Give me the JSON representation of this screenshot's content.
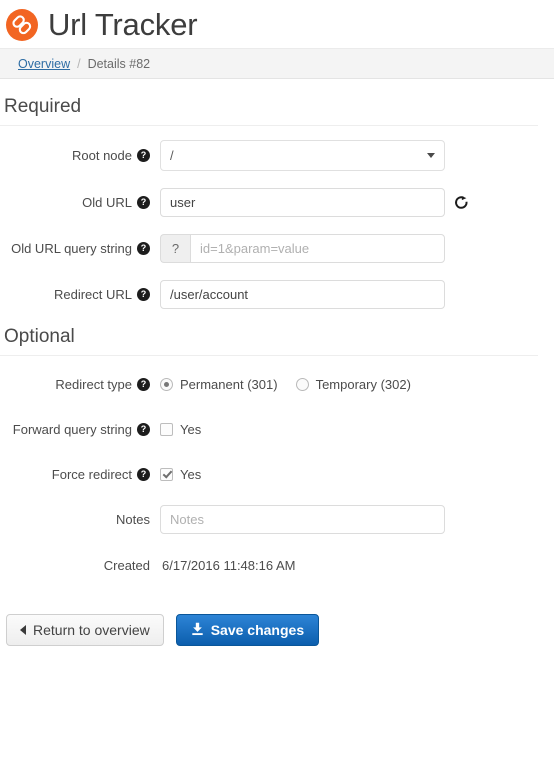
{
  "header": {
    "title": "Url Tracker",
    "logo_icon": "chain-link-icon",
    "logo_color": "#f26522"
  },
  "breadcrumb": {
    "link_label": "Overview",
    "separator": "/",
    "current_label": "Details #82"
  },
  "sections": {
    "required": {
      "title": "Required",
      "root_node": {
        "label": "Root node",
        "help_icon": "question-circle-icon",
        "value": "/",
        "caret_icon": "chevron-down-icon"
      },
      "old_url": {
        "label": "Old URL",
        "help_icon": "question-circle-icon",
        "value": "user",
        "placeholder": "",
        "action_icon": "external-link-icon"
      },
      "old_url_query_string": {
        "label": "Old URL query string",
        "help_icon": "question-circle-icon",
        "addon": "?",
        "value": "",
        "placeholder": "id=1&param=value"
      },
      "redirect_url": {
        "label": "Redirect URL",
        "help_icon": "question-circle-icon",
        "value": "/user/account",
        "placeholder": ""
      }
    },
    "optional": {
      "title": "Optional",
      "redirect_type": {
        "label": "Redirect type",
        "help_icon": "question-circle-icon",
        "options": [
          {
            "label": "Permanent (301)",
            "selected": true
          },
          {
            "label": "Temporary (302)",
            "selected": false
          }
        ]
      },
      "forward_query_string": {
        "label": "Forward query string",
        "help_icon": "question-circle-icon",
        "checkbox_label": "Yes",
        "checked": false
      },
      "force_redirect": {
        "label": "Force redirect",
        "help_icon": "question-circle-icon",
        "checkbox_label": "Yes",
        "checked": true
      },
      "notes": {
        "label": "Notes",
        "value": "",
        "placeholder": "Notes"
      },
      "created": {
        "label": "Created",
        "value": "6/17/2016 11:48:16 AM"
      }
    }
  },
  "buttons": {
    "return": {
      "label": "Return to overview",
      "icon": "chevron-left-icon"
    },
    "save": {
      "label": "Save changes",
      "icon": "save-icon",
      "color": "#1565ad"
    }
  },
  "help_glyph": "?"
}
